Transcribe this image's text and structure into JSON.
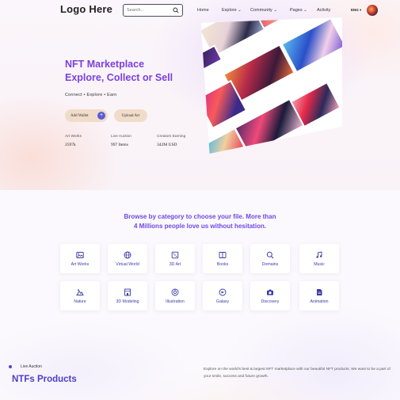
{
  "header": {
    "logo": "Logo Here",
    "search_placeholder": "Search...",
    "nav": [
      {
        "label": "Home"
      },
      {
        "label": "Explore"
      },
      {
        "label": "Community"
      },
      {
        "label": "Pages"
      },
      {
        "label": "Activity"
      }
    ],
    "language": "ENG"
  },
  "hero": {
    "title_line1": "NFT Marketplace",
    "title_line2": "Explore, Collect or Sell",
    "subtitle": "Connect  •  Explore  •  Earn",
    "add_wallet": "Add Wallet",
    "upload_art": "Upload Art",
    "stats": [
      {
        "label": "Art Works",
        "value": "2597k"
      },
      {
        "label": "Live Auction",
        "value": "997 Items"
      },
      {
        "label": "Creators Earning",
        "value": "342M USD"
      }
    ]
  },
  "categories": {
    "heading_line1": "Browse by category to choose your file. More than",
    "heading_line2": "4 Millions people love us without hesitation.",
    "items": [
      {
        "label": "Art Works",
        "icon": "image-icon"
      },
      {
        "label": "Virtual World",
        "icon": "globe-icon"
      },
      {
        "label": "3D Art",
        "icon": "cube-icon"
      },
      {
        "label": "Books",
        "icon": "book-icon"
      },
      {
        "label": "Domains",
        "icon": "search-icon"
      },
      {
        "label": "Music",
        "icon": "music-icon"
      },
      {
        "label": "Nature",
        "icon": "nature-icon"
      },
      {
        "label": "3D Modeling",
        "icon": "building-icon"
      },
      {
        "label": "Illustration",
        "icon": "palette-icon"
      },
      {
        "label": "Galaxy",
        "icon": "galaxy-icon"
      },
      {
        "label": "Discovery",
        "icon": "camera-icon"
      },
      {
        "label": "Animation",
        "icon": "document-icon"
      }
    ]
  },
  "products": {
    "live_label": "Live Auction",
    "title": "NTFs Products",
    "description": "Explore on the world's best & largest NFT marketplace with our beautiful NFT products. We want to be a part of your smile, success and future growth."
  },
  "colors": {
    "accent": "#7b3fe0",
    "button": "#f1dcc9",
    "icon_blue": "#3a3aa8"
  }
}
